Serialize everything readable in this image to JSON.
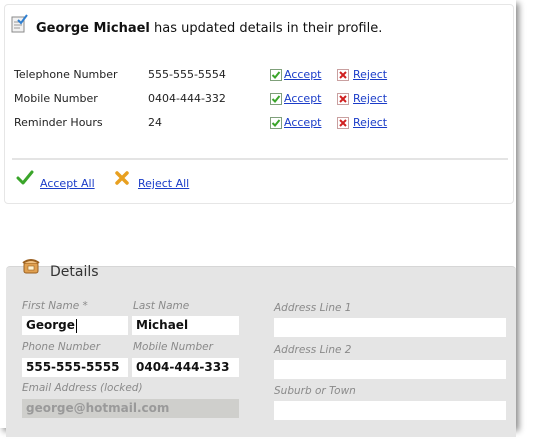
{
  "notice": {
    "user_name": "George Michael",
    "message": " has updated details in their profile.",
    "changes": [
      {
        "field": "Telephone Number",
        "value": "555-555-5554",
        "accept": "Accept",
        "reject": "Reject"
      },
      {
        "field": "Mobile Number",
        "value": "0404-444-332",
        "accept": "Accept",
        "reject": "Reject"
      },
      {
        "field": "Reminder Hours",
        "value": "24",
        "accept": "Accept",
        "reject": "Reject"
      }
    ],
    "accept_all": "Accept All",
    "reject_all": "Reject All"
  },
  "details": {
    "title": "Details",
    "first_name_label": "First Name *",
    "first_name_value": "George",
    "last_name_label": "Last Name",
    "last_name_value": "Michael",
    "phone_label": "Phone Number",
    "phone_value": "555-555-5555",
    "mobile_label": "Mobile Number",
    "mobile_value": "0404-444-333",
    "email_label": "Email Address (locked)",
    "email_value": "george@hotmail.com",
    "address1_label": "Address Line 1",
    "address1_value": "",
    "address2_label": "Address Line 2",
    "address2_value": "",
    "suburb_label": "Suburb or Town",
    "suburb_value": ""
  },
  "icons": {
    "notice": "profile-update-icon",
    "accept": "checkbox-check-icon",
    "reject": "red-x-icon",
    "accept_all": "green-check-icon",
    "reject_all": "orange-x-icon",
    "details": "phone-icon"
  },
  "colors": {
    "link": "#1a3cc8",
    "accept_green": "#3aa52a",
    "reject_red": "#d02020",
    "reject_orange": "#e8a020",
    "panel_bg": "#e5e5e5"
  }
}
